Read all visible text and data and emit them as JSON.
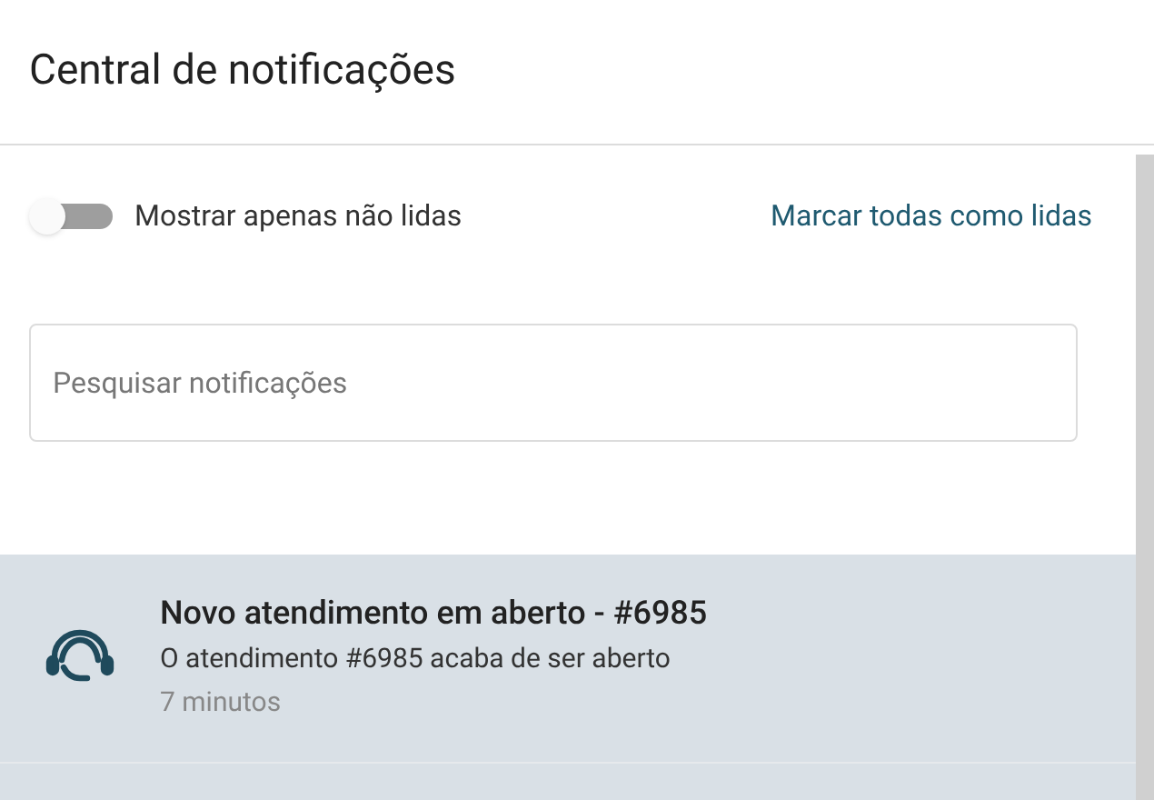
{
  "header": {
    "title": "Central de notificações"
  },
  "filter": {
    "label": "Mostrar apenas não lidas",
    "on": false
  },
  "mark_all_link": "Marcar todas como lidas",
  "search": {
    "placeholder": "Pesquisar notificações"
  },
  "notifications": [
    {
      "title": "Novo atendimento em aberto - #6985",
      "message": "O atendimento #6985 acaba de ser aberto",
      "time": "7 minutos",
      "read": false
    }
  ]
}
